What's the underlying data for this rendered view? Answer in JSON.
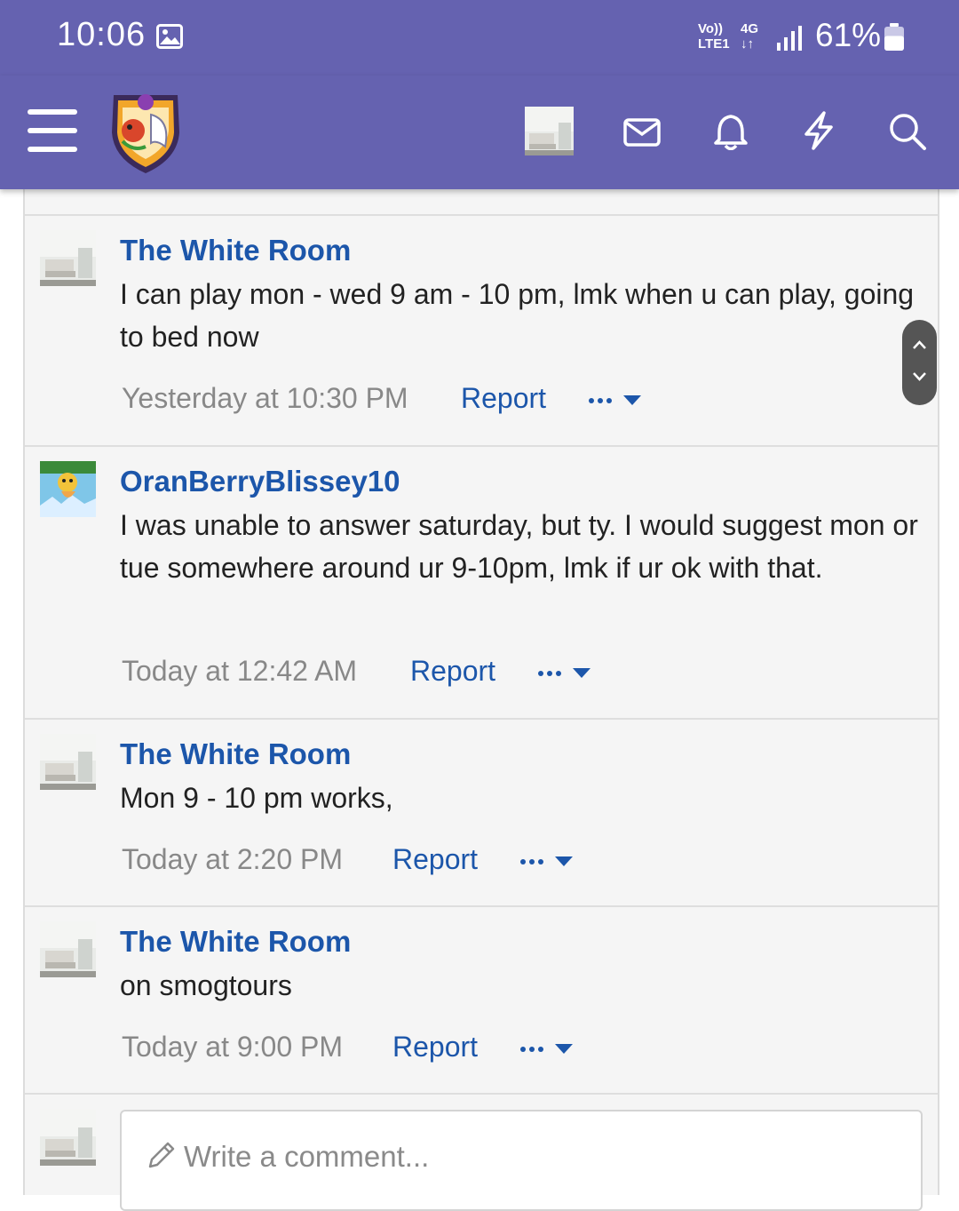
{
  "status_bar": {
    "time": "10:06",
    "network_top": "Vo))",
    "network_bottom": "LTE1",
    "data_top": "4G",
    "data_bottom": "↓↑",
    "battery_text": "61%",
    "battery_level": 0.61
  },
  "nav": {
    "icons": [
      "menu-icon",
      "site-logo",
      "user-avatar",
      "mail-icon",
      "bell-icon",
      "bolt-icon",
      "search-icon"
    ]
  },
  "comments": [
    {
      "author": "The White Room",
      "text": "I can play mon - wed 9 am - 10 pm, lmk when u can play, going to bed now",
      "time": "Yesterday at 10:30 PM",
      "report_label": "Report",
      "more_label": "•••"
    },
    {
      "author": "OranBerryBlissey10",
      "text": "I was unable to answer saturday, but ty. I would suggest mon or tue somewhere around ur 9-10pm, lmk if ur ok with that.",
      "time": "Today at 12:42 AM",
      "report_label": "Report",
      "more_label": "•••"
    },
    {
      "author": "The White Room",
      "text": "Mon 9 - 10 pm works,",
      "time": "Today at 2:20 PM",
      "report_label": "Report",
      "more_label": "•••"
    },
    {
      "author": "The White Room",
      "text": "on smogtours",
      "time": "Today at 9:00 PM",
      "report_label": "Report",
      "more_label": "•••"
    }
  ],
  "reply": {
    "placeholder": "Write a comment..."
  },
  "colors": {
    "header": "#6562b0",
    "link": "#1c56aa",
    "meta": "#888888",
    "panel": "#f5f5f5"
  }
}
